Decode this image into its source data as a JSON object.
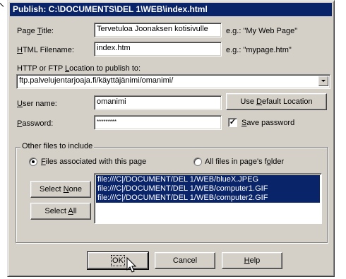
{
  "dialog": {
    "title": "Publish: C:\\DOCUMENTS\\DEL 1\\WEB\\index.html"
  },
  "page_title": {
    "label_before": "Page ",
    "label_key": "T",
    "label_after": "itle:",
    "value": "Tervetuloa Joonaksen kotisivulle",
    "hint": "e.g.: \"My Web Page\""
  },
  "html_filename": {
    "label_key": "H",
    "label_after": "TML Filename:",
    "value": "index.htm",
    "hint": "e.g.: \"mypage.htm\""
  },
  "location": {
    "label_before": "HTTP or FTP ",
    "label_key": "L",
    "label_after": "ocation to publish to:",
    "value": "ftp.palvelujentarjoaja.fi/käyttäjänimi/omanimi/"
  },
  "user_name": {
    "label_key": "U",
    "label_after": "ser name:",
    "value": "omanimi"
  },
  "password": {
    "label_key": "P",
    "label_after": "assword:",
    "value": "*********"
  },
  "use_default_location": {
    "label_before": "Use ",
    "label_key": "D",
    "label_after": "efault Location"
  },
  "save_password": {
    "check_mark": "✓",
    "label_key": "S",
    "label_after": "ave password",
    "checked": true
  },
  "other_files": {
    "group_title": "Other files to include",
    "radio_associated": {
      "label_key": "F",
      "label_after": "iles associated with this page",
      "checked": true
    },
    "radio_all": {
      "label_before": "All files in page's f",
      "label_key": "o",
      "label_after": "lder",
      "checked": false
    },
    "select_none": {
      "label_before": "Select ",
      "label_key": "N",
      "label_after": "one"
    },
    "select_all": {
      "label_before": "Select ",
      "label_key": "A",
      "label_after": "ll"
    },
    "files": [
      "file:///C|/DOCUMENT/DEL 1/WEB/blueX.JPEG",
      "file:///C|/DOCUMENT/DEL 1/WEB/computer1.GIF",
      "file:///C|/DOCUMENT/DEL 1/WEB/computer2.GIF"
    ]
  },
  "buttons": {
    "ok": "OK",
    "cancel": "Cancel",
    "help_key": "H",
    "help_after": "elp"
  },
  "colors": {
    "titlebar": "#0a246a",
    "face": "#d4d0c8",
    "selection": "#0a246a"
  },
  "icons": {
    "cursor": "mouse-pointer-icon",
    "dropdown": "chevron-down-icon"
  }
}
